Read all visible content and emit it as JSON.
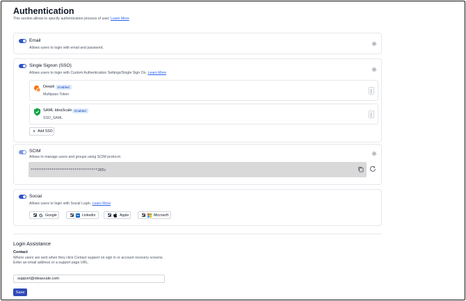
{
  "page": {
    "title": "Authentication",
    "description": "This section allows to specify authentication process of user.",
    "learn_more": "Learn More"
  },
  "email": {
    "title": "Email",
    "description": "Allows users to login with email and password.",
    "enabled": true
  },
  "sso": {
    "title": "Single Signon (SSO)",
    "description": "Allows users to login with Custom Authentication Settings/Single Sign On.",
    "learn_more": "Learn More",
    "enabled": true,
    "providers": [
      {
        "name": "Deepti",
        "status": "Enabled",
        "type": "Multipass Token",
        "icon": "multipass-icon"
      },
      {
        "name": "SAML IdeaScale",
        "status": "Enabled",
        "type": "SSO_SAML",
        "icon": "shield-icon"
      }
    ],
    "add_label": "Add SSO"
  },
  "scim": {
    "title": "SCIM",
    "description": "Allows to manage users and groups using SCIM protocol.",
    "token": "********************************265c",
    "enabled": true
  },
  "social": {
    "title": "Social",
    "description": "Allows users to login with Social Login.",
    "learn_more": "Learn More",
    "enabled": true,
    "providers": [
      {
        "label": "Google",
        "icon": "google-icon",
        "checked": true
      },
      {
        "label": "Linkedin",
        "icon": "linkedin-icon",
        "checked": true
      },
      {
        "label": "Apple",
        "icon": "apple-icon",
        "checked": true
      },
      {
        "label": "Microsoft",
        "icon": "microsoft-icon",
        "checked": true
      }
    ]
  },
  "login_assistance": {
    "title": "Login Assistance",
    "contact_label": "Contact",
    "help_line1": "Where users are sent when they click Contact support on sign in or account recovery screens.",
    "help_line2": "Enter an email address or a support page URL.",
    "contact_value": "support@ideascale.com",
    "save_label": "Save"
  },
  "colors": {
    "accent": "#2f54c9",
    "save": "#2f4ab8",
    "badge_bg": "#dbeafe",
    "link": "#2563eb"
  }
}
